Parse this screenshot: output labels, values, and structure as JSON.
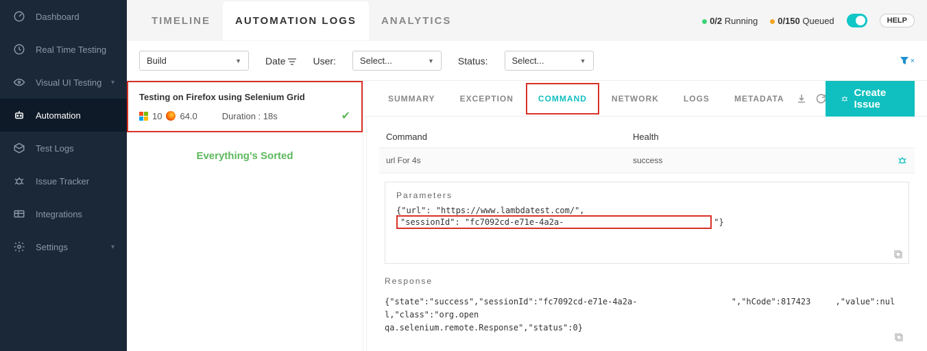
{
  "sidebar": {
    "items": [
      {
        "label": "Dashboard"
      },
      {
        "label": "Real Time Testing"
      },
      {
        "label": "Visual UI Testing"
      },
      {
        "label": "Automation"
      },
      {
        "label": "Test Logs"
      },
      {
        "label": "Issue Tracker"
      },
      {
        "label": "Integrations"
      },
      {
        "label": "Settings"
      }
    ]
  },
  "top_tabs": {
    "timeline": "TIMELINE",
    "automation_logs": "AUTOMATION LOGS",
    "analytics": "ANALYTICS"
  },
  "status": {
    "running_count": "0/2",
    "running_label": "Running",
    "queued_count": "0/150",
    "queued_label": "Queued"
  },
  "help": "HELP",
  "filters": {
    "build_label": "Build",
    "date_label": "Date",
    "user_label": "User:",
    "user_placeholder": "Select...",
    "status_label": "Status:",
    "status_placeholder": "Select...",
    "clear_symbol": "×"
  },
  "test_card": {
    "title": "Testing on Firefox using Selenium Grid",
    "os_version": "10",
    "browser_version": "64.0",
    "duration": "Duration : 18s"
  },
  "sorted_msg": "Everything's Sorted",
  "detail_tabs": {
    "summary": "SUMMARY",
    "exception": "EXCEPTION",
    "command": "COMMAND",
    "network": "NETWORK",
    "logs": "LOGS",
    "metadata": "METADATA"
  },
  "create_issue": "Create Issue",
  "command_table": {
    "header_command": "Command",
    "header_health": "Health",
    "row_command": "url For 4s",
    "row_health": "success"
  },
  "parameters": {
    "title": "Parameters",
    "prefix": "{\"url\": \"https://www.lambdatest.com/\",",
    "highlighted": "\"sessionId\": \"fc7092cd-e71e-4a2a-",
    "suffix": "\"}"
  },
  "response": {
    "title": "Response",
    "line1_a": "{\"state\":\"success\",\"sessionId\":\"fc7092cd-e71e-4a2a-",
    "line1_b": "\",\"hCode\":817423",
    "line1_c": ",\"value\":null,\"class\":\"org.open",
    "line2": "qa.selenium.remote.Response\",\"status\":0}"
  }
}
